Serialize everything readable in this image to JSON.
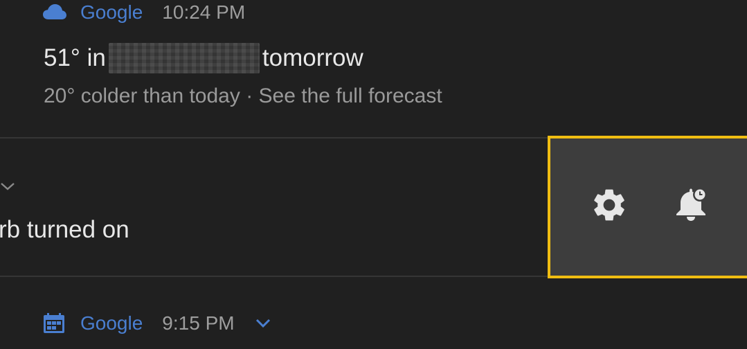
{
  "weather_notification": {
    "app_name": "Google",
    "time": "10:24 PM",
    "title_prefix": "51° in",
    "title_suffix": "tomorrow",
    "subtitle": "20° colder than today · See the full forecast",
    "icon": "cloud-icon"
  },
  "dnd_notification": {
    "text": "rb turned on",
    "expand_icon": "chevron-down-icon",
    "actions": [
      {
        "name": "settings",
        "icon": "gear-icon"
      },
      {
        "name": "snooze",
        "icon": "bell-clock-icon"
      }
    ],
    "highlight_color": "#f0bd12"
  },
  "calendar_notification": {
    "app_name": "Google",
    "time": "9:15 PM",
    "icon": "calendar-icon",
    "expand_icon": "chevron-down-icon"
  },
  "colors": {
    "background": "#202020",
    "app_name": "#4a7fd1",
    "primary_text": "#e8e8e8",
    "secondary_text": "#9a9a9a",
    "panel": "#3d3d3d"
  }
}
